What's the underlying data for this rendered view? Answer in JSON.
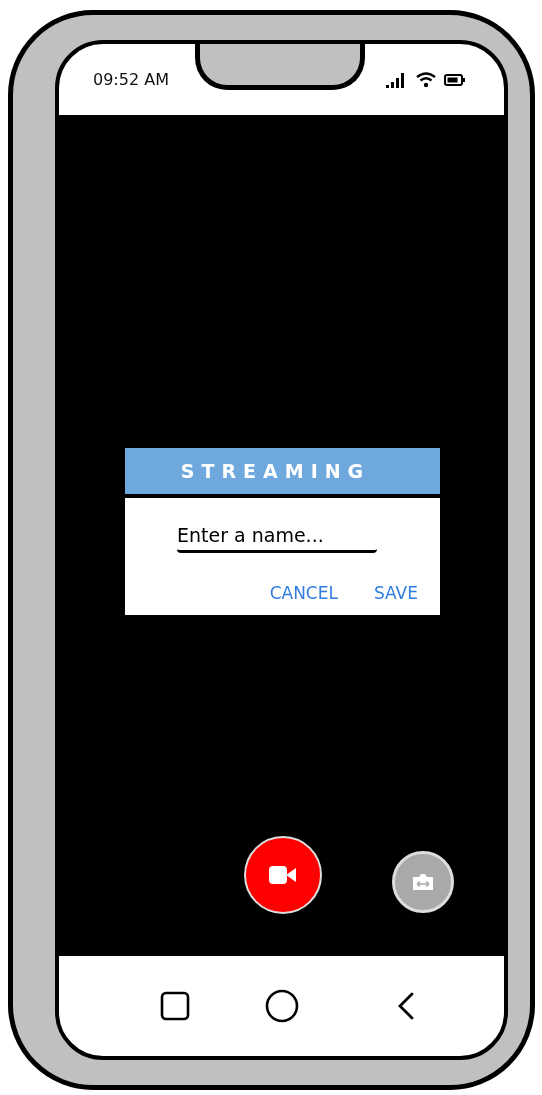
{
  "status_bar": {
    "time": "09:52 AM"
  },
  "dialog": {
    "title": "STREAMING",
    "name_field": {
      "placeholder": "Enter a name..."
    },
    "buttons": [
      "CANCEL",
      "SAVE"
    ]
  }
}
